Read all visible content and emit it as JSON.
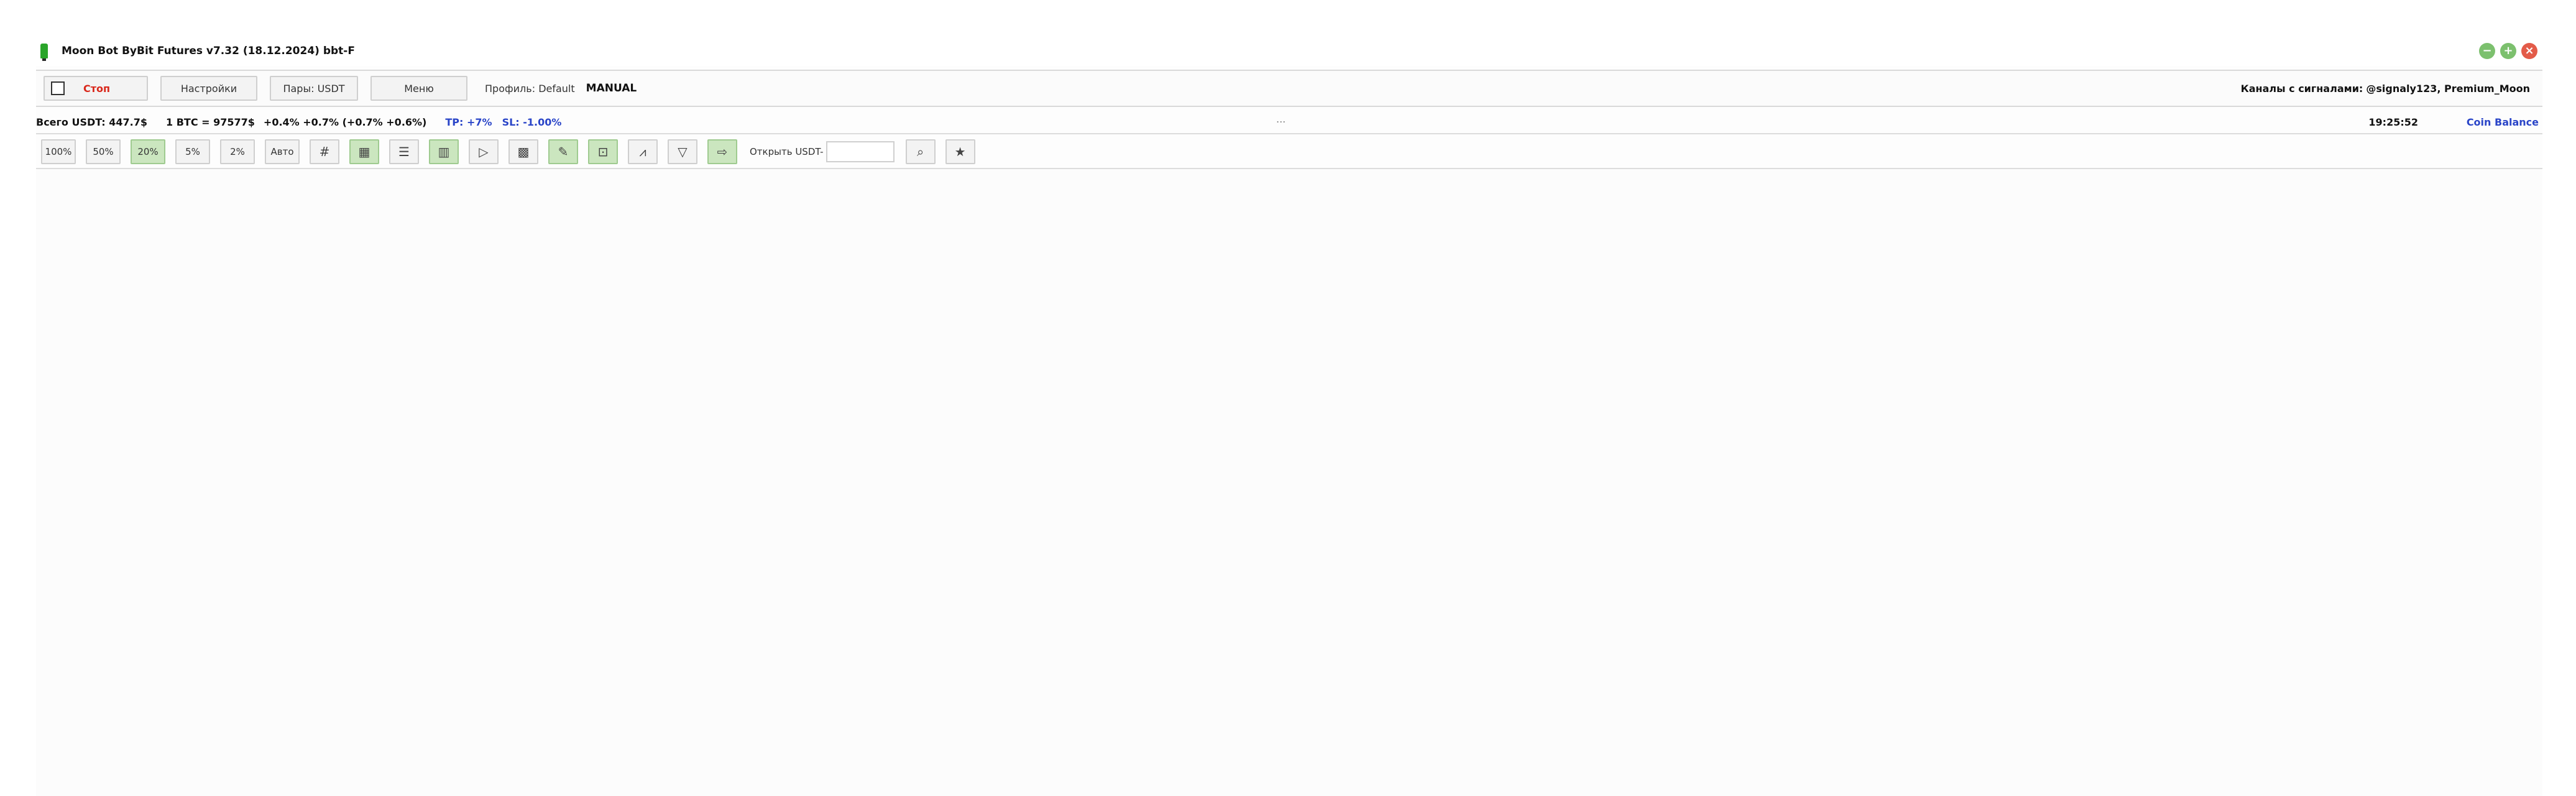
{
  "window": {
    "title": "Moon Bot ByBit Futures v7.32 (18.12.2024) bbt-F"
  },
  "toolbar1": {
    "stop_label": "Стоп",
    "settings_label": "Настройки",
    "pairs_label": "Пары: USDT",
    "menu_label": "Меню",
    "profiles_label": "Профиль: Default",
    "profile_mode": "MANUAL",
    "channels_label": "Каналы с сигналами:",
    "channels_value": "@signaly123, Premium_Moon"
  },
  "infobar": {
    "total": "Всего USDT: 447.7$",
    "btc": "1 BTC = 97577$",
    "changes": "+0.4% +0.7% (+0.7% +0.6%)",
    "tp": "TP: +7%",
    "sl": "SL: -1.00%",
    "dots": "...",
    "clock": "19:25:52",
    "coin_balance": "Coin Balance"
  },
  "toolbar2": {
    "percents": [
      "100%",
      "50%",
      "20%",
      "5%",
      "2%",
      "Авто"
    ],
    "active_percent": "20%",
    "icons": [
      "hash-icon",
      "grid-icon",
      "list-icon",
      "bar-chart-icon",
      "flag-icon",
      "checkered-icon",
      "pencil-icon",
      "chart-bracket-icon",
      "line-chart-icon",
      "filter-icon",
      "arrow-right-icon"
    ],
    "open_label": "Открыть USDT-",
    "open_value": "",
    "search_icon": "search-icon",
    "star_icon": "star-icon"
  },
  "colors": {
    "accent_green": "#cbe6bf",
    "stop_red": "#d9281b",
    "link_blue": "#2a45c8"
  }
}
